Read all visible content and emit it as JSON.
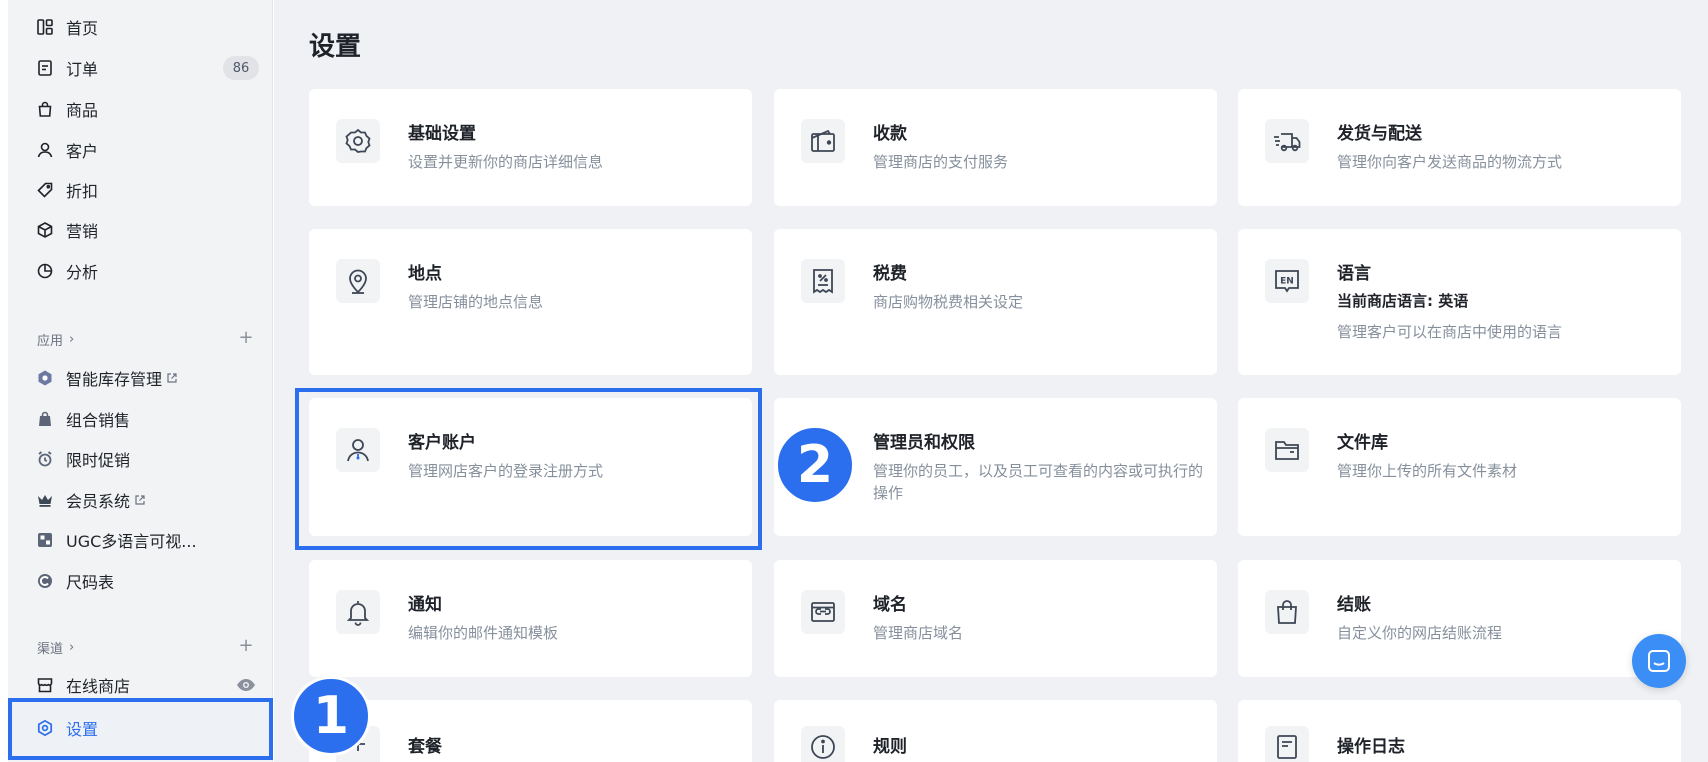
{
  "sidebar": {
    "nav": [
      {
        "label": "首页",
        "icon": "dashboard-icon"
      },
      {
        "label": "订单",
        "icon": "order-icon",
        "badge": "86"
      },
      {
        "label": "商品",
        "icon": "bag-icon"
      },
      {
        "label": "客户",
        "icon": "user-icon"
      },
      {
        "label": "折扣",
        "icon": "tag-icon"
      },
      {
        "label": "营销",
        "icon": "cube-icon"
      },
      {
        "label": "分析",
        "icon": "pie-chart-icon"
      }
    ],
    "apps_label": "应用",
    "apps": [
      {
        "label": "智能库存管理",
        "icon": "hexagon-icon",
        "external": true
      },
      {
        "label": "组合销售",
        "icon": "bag-fill-icon"
      },
      {
        "label": "限时促销",
        "icon": "alarm-clock-icon"
      },
      {
        "label": "会员系统",
        "icon": "crown-icon",
        "external": true
      },
      {
        "label": "UGC多语言可视...",
        "icon": "gallery-icon"
      },
      {
        "label": "尺码表",
        "icon": "ruler-c-icon"
      }
    ],
    "channels_label": "渠道",
    "channels": [
      {
        "label": "在线商店",
        "icon": "store-icon"
      }
    ],
    "settings_label": "设置"
  },
  "main": {
    "title": "设置",
    "cards": [
      {
        "title": "基础设置",
        "desc": "设置并更新你的商店详细信息",
        "icon": "gear-icon"
      },
      {
        "title": "收款",
        "desc": "管理商店的支付服务",
        "icon": "wallet-icon"
      },
      {
        "title": "发货与配送",
        "desc": "管理你向客户发送商品的物流方式",
        "icon": "truck-icon"
      },
      {
        "title": "地点",
        "desc": "管理店铺的地点信息",
        "icon": "location-pin-icon"
      },
      {
        "title": "税费",
        "desc": "商店购物税费相关设定",
        "icon": "receipt-percent-icon"
      },
      {
        "title": "语言",
        "subtitle": "当前商店语言: 英语",
        "desc": "管理客户可以在商店中使用的语言",
        "icon": "language-en-icon"
      },
      {
        "title": "客户账户",
        "desc": "管理网店客户的登录注册方式",
        "icon": "customer-account-icon"
      },
      {
        "title": "管理员和权限",
        "desc": "管理你的员工，以及员工可查看的内容或可执行的操作",
        "icon": "admin-icon"
      },
      {
        "title": "文件库",
        "desc": "管理你上传的所有文件素材",
        "icon": "folder-icon"
      },
      {
        "title": "通知",
        "desc": "编辑你的邮件通知模板",
        "icon": "bell-icon"
      },
      {
        "title": "域名",
        "desc": "管理商店域名",
        "icon": "domain-link-icon"
      },
      {
        "title": "结账",
        "desc": "自定义你的网店结账流程",
        "icon": "shopping-bag-icon"
      },
      {
        "title": "套餐",
        "desc": "",
        "icon": "plan-add-icon"
      },
      {
        "title": "规则",
        "desc": "",
        "icon": "info-icon"
      },
      {
        "title": "操作日志",
        "desc": "",
        "icon": "log-icon"
      }
    ]
  },
  "annotations": {
    "step1": "1",
    "step2": "2"
  },
  "colors": {
    "accent": "#2b6fee",
    "sidebar_bg": "#f2f3f5",
    "main_bg": "#eff1f4",
    "card_bg": "#ffffff",
    "muted_text": "#86909c",
    "chat_button": "#3a8ef6"
  }
}
